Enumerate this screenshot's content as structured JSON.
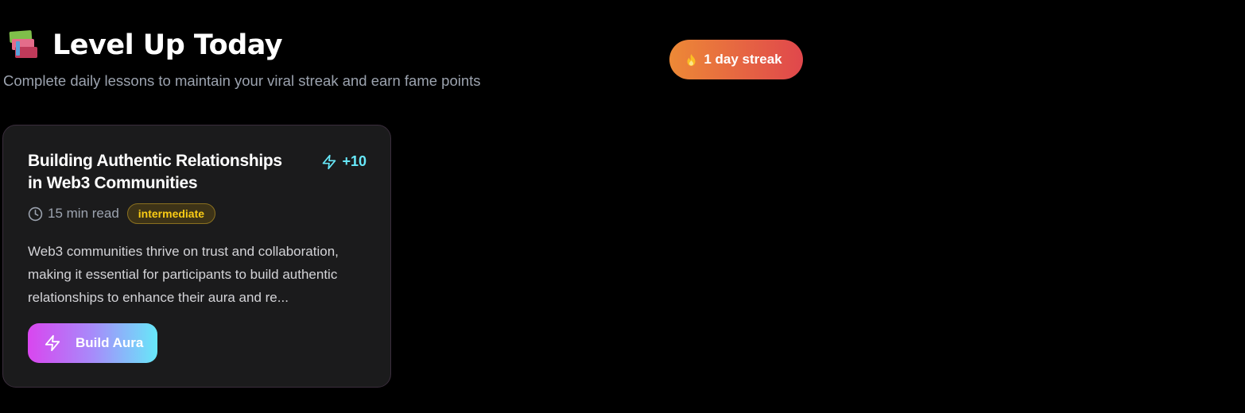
{
  "header": {
    "icon": "books-icon",
    "title": "Level Up Today",
    "subtitle": "Complete daily lessons to maintain your viral streak and earn fame points"
  },
  "streak": {
    "icon": "flame-icon",
    "label": "1 day streak",
    "gradient": [
      "#ed8936",
      "#e0474c"
    ]
  },
  "lesson_card": {
    "title": "Building Authentic Relationships in Web3 Communities",
    "points": {
      "icon": "lightning-icon",
      "label": "+10",
      "color": "#67e8f9"
    },
    "read_time": {
      "icon": "clock-icon",
      "label": "15 min read"
    },
    "level": {
      "label": "intermediate",
      "color": "#facc15"
    },
    "description": "Web3 communities thrive on trust and collaboration, making it essential for participants to build authentic relationships to enhance their aura and re...",
    "cta": {
      "icon": "lightning-icon",
      "label": "Build Aura",
      "gradient": [
        "#d946ef",
        "#a78bfa",
        "#67e8f9"
      ]
    }
  }
}
